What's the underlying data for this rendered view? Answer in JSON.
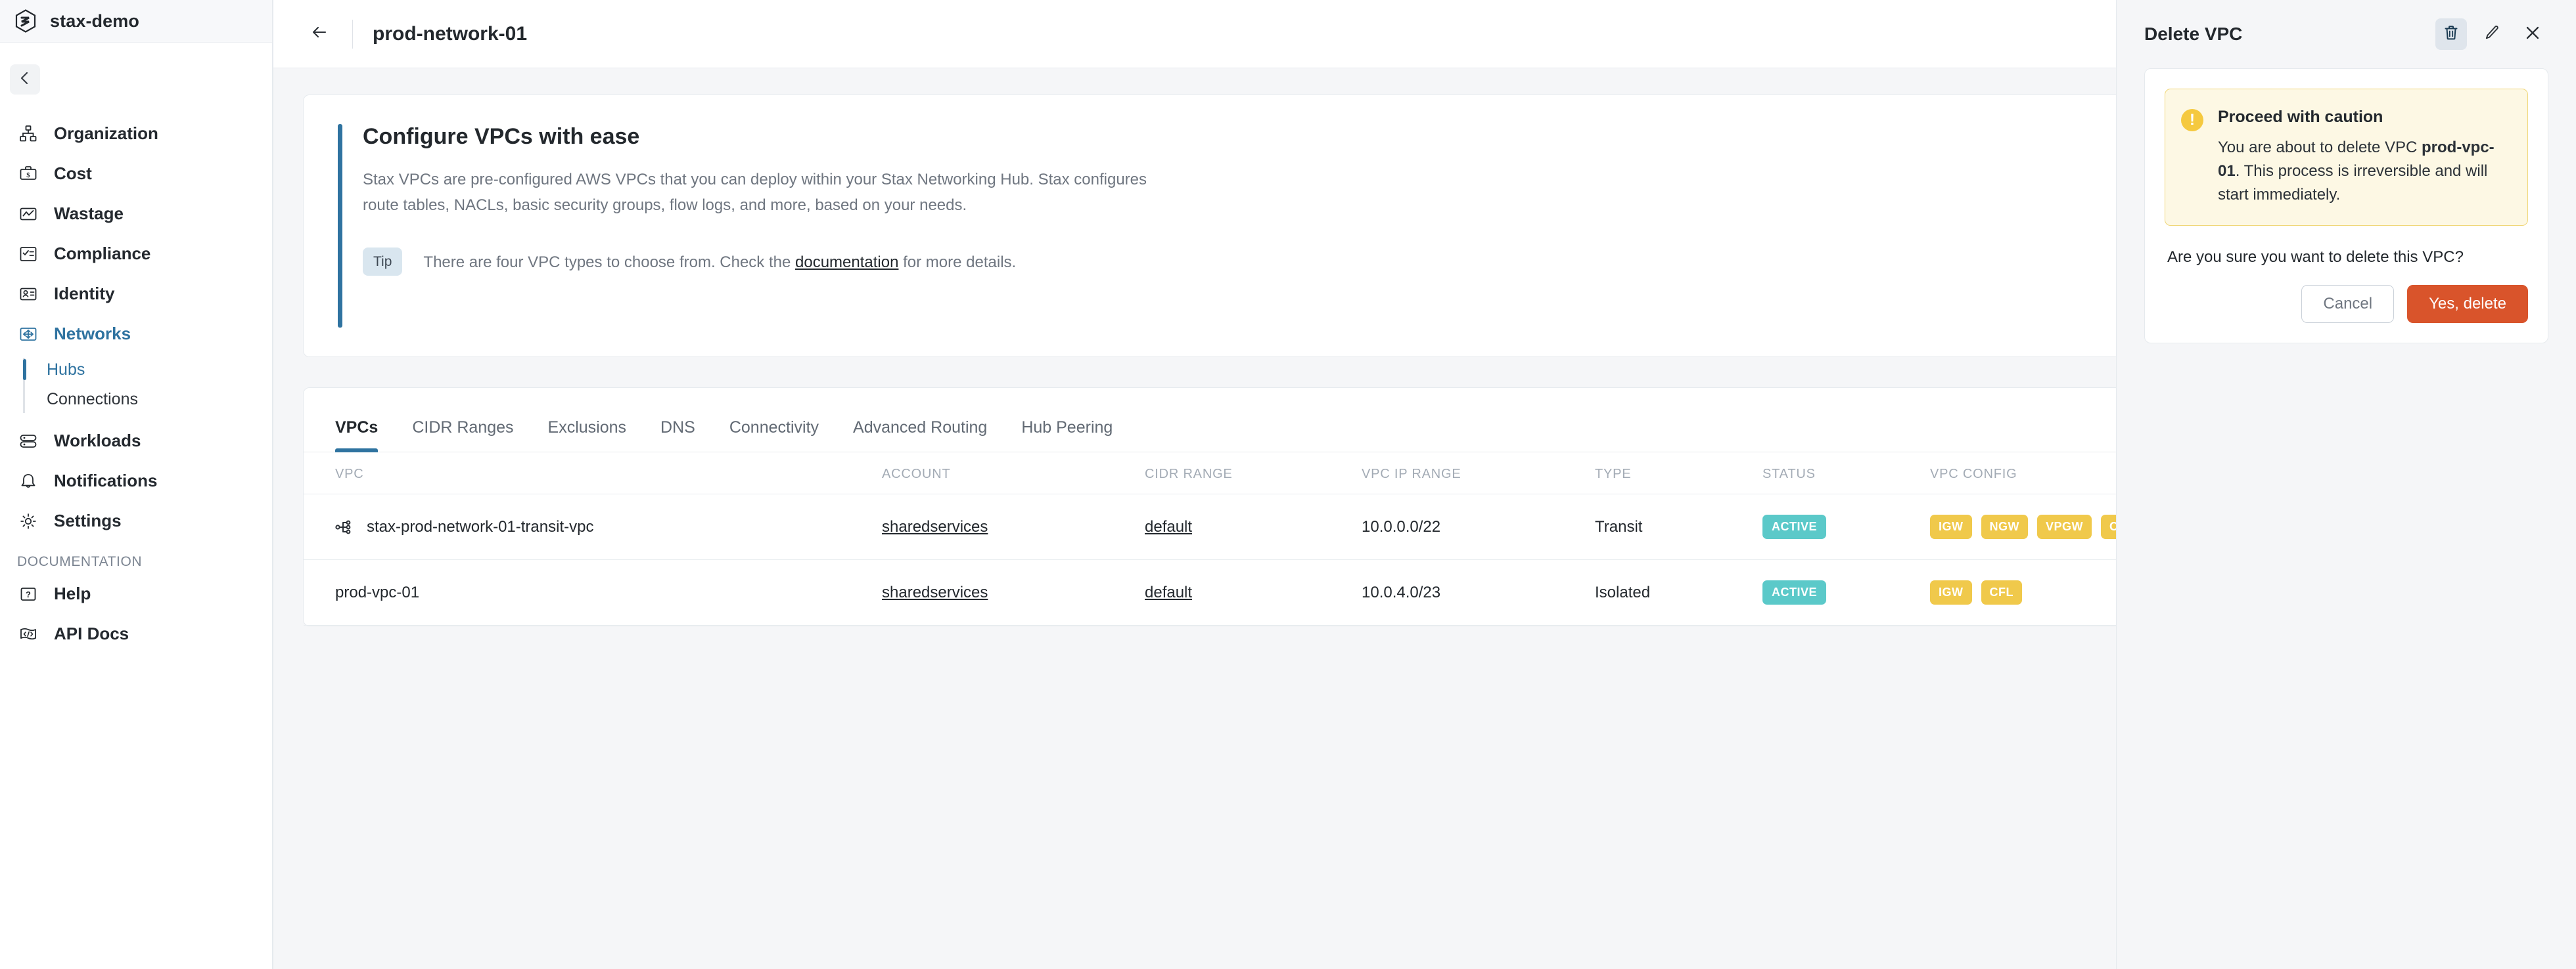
{
  "brand": {
    "name": "stax-demo",
    "logo_icon": "stax-hexagon-logo"
  },
  "sidebar": {
    "collapse_icon": "chevron-left-icon",
    "items": [
      {
        "label": "Organization",
        "icon": "organization-icon"
      },
      {
        "label": "Cost",
        "icon": "briefcase-dollar-icon"
      },
      {
        "label": "Wastage",
        "icon": "chart-line-icon"
      },
      {
        "label": "Compliance",
        "icon": "checklist-icon"
      },
      {
        "label": "Identity",
        "icon": "id-card-icon"
      },
      {
        "label": "Networks",
        "icon": "network-arrows-icon",
        "active": true
      },
      {
        "label": "Workloads",
        "icon": "server-stack-icon"
      },
      {
        "label": "Notifications",
        "icon": "bell-icon"
      },
      {
        "label": "Settings",
        "icon": "gear-icon"
      }
    ],
    "subitems": [
      {
        "label": "Hubs",
        "active": true
      },
      {
        "label": "Connections",
        "active": false
      }
    ],
    "section_label": "DOCUMENTATION",
    "doc_items": [
      {
        "label": "Help",
        "icon": "question-box-icon"
      },
      {
        "label": "API Docs",
        "icon": "code-tag-icon"
      }
    ]
  },
  "header": {
    "back_icon": "arrow-left-icon",
    "title": "prod-network-01"
  },
  "promo": {
    "title": "Configure VPCs with ease",
    "body": "Stax VPCs are pre-configured AWS VPCs that you can deploy within your Stax Networking Hub. Stax configures route tables, NACLs, basic security groups, flow logs, and more, based on your needs.",
    "tip_badge": "Tip",
    "tip_prefix": "There are four VPC types to choose from. Check the ",
    "tip_link": "documentation",
    "tip_suffix": " for more details."
  },
  "tabs": [
    {
      "label": "VPCs",
      "active": true
    },
    {
      "label": "CIDR Ranges",
      "active": false
    },
    {
      "label": "Exclusions",
      "active": false
    },
    {
      "label": "DNS",
      "active": false
    },
    {
      "label": "Connectivity",
      "active": false
    },
    {
      "label": "Advanced Routing",
      "active": false
    },
    {
      "label": "Hub Peering",
      "active": false
    }
  ],
  "table": {
    "columns": [
      "VPC",
      "ACCOUNT",
      "CIDR RANGE",
      "VPC IP RANGE",
      "TYPE",
      "STATUS",
      "VPC CONFIG"
    ],
    "rows": [
      {
        "vpc": "stax-prod-network-01-transit-vpc",
        "vpc_icon": "network-node-icon",
        "account": "sharedservices",
        "cidr_range": "default",
        "ip_range": "10.0.0.0/22",
        "type": "Transit",
        "status": "ACTIVE",
        "config": [
          "IGW",
          "NGW",
          "VPGW",
          "CFL"
        ]
      },
      {
        "vpc": "prod-vpc-01",
        "vpc_icon": null,
        "account": "sharedservices",
        "cidr_range": "default",
        "ip_range": "10.0.4.0/23",
        "type": "Isolated",
        "status": "ACTIVE",
        "config": [
          "IGW",
          "CFL"
        ]
      }
    ]
  },
  "panel": {
    "title": "Delete VPC",
    "icons": [
      {
        "name": "trash-icon",
        "selected": true
      },
      {
        "name": "pencil-icon",
        "selected": false
      },
      {
        "name": "close-icon",
        "selected": false
      }
    ],
    "warning": {
      "icon": "exclamation-circle-icon",
      "icon_glyph": "!",
      "title": "Proceed with caution",
      "text_before": "You are about to delete VPC ",
      "vpc_name": "prod-vpc-01",
      "text_after": ". This process is irreversible and will start immediately."
    },
    "confirm_question": "Are you sure you want to delete this VPC?",
    "cancel_label": "Cancel",
    "delete_label": "Yes, delete"
  },
  "colors": {
    "accent_blue": "#2f73a0",
    "danger": "#d9542b",
    "status_active": "#5bc9c9",
    "config_badge": "#f0c94b",
    "warning_bg": "#fdf8e4",
    "warning_border": "#f0d779"
  }
}
